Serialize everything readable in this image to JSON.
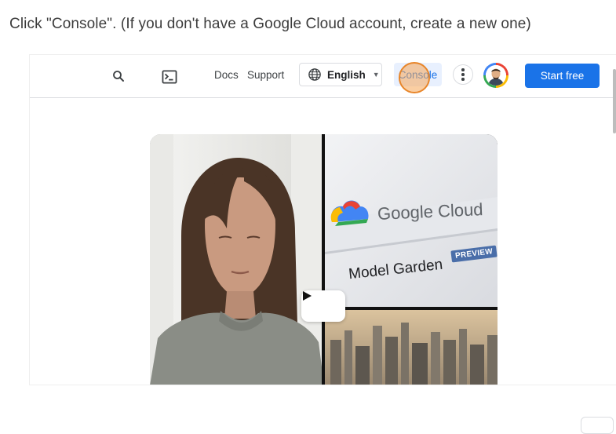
{
  "instruction": {
    "text": "Click \"Console\". (If you don't have a Google Cloud account, create a new one)"
  },
  "header": {
    "search_icon": "search-icon",
    "shell_icon": "terminal-icon",
    "docs_label": "Docs",
    "support_label": "Support",
    "language": {
      "icon": "globe-icon",
      "selected": "English"
    },
    "console_label": "Console",
    "more_icon": "more-vert-icon",
    "start_label": "Start free"
  },
  "video": {
    "brand_text": "Google Cloud",
    "product_text": "Model Garden",
    "badge_text": "PREVIEW",
    "play_icon": "play-icon"
  },
  "colors": {
    "accent": "#1a73e8",
    "console_bg": "#e8f0fe",
    "click_marker": "#f5a655",
    "divider": "#dadce0"
  }
}
